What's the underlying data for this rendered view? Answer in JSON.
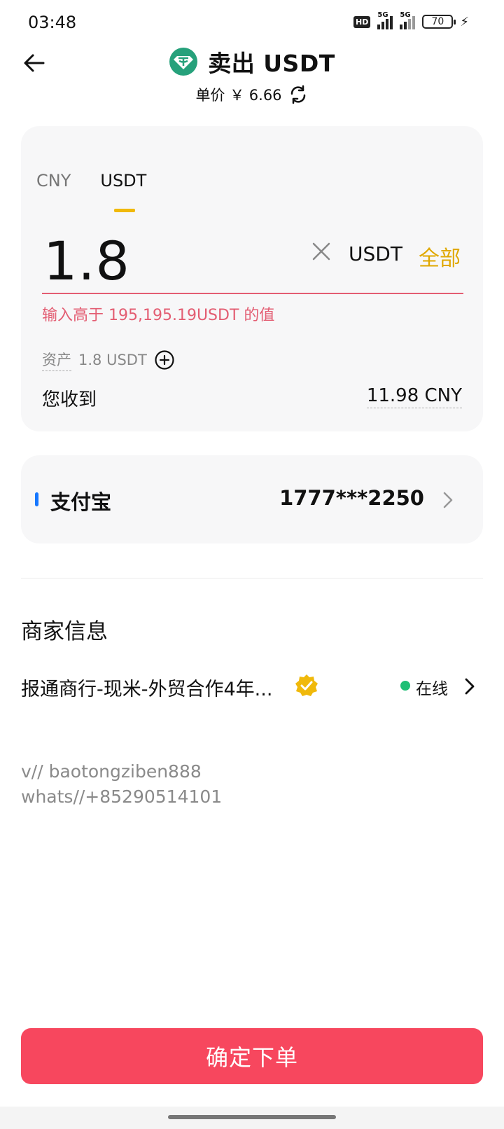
{
  "status_bar": {
    "time": "03:48",
    "hd_badge": "HD",
    "signal1_tag": "5G",
    "signal2_tag": "5G",
    "battery": "70"
  },
  "header": {
    "back_icon": "arrow-left-icon",
    "coin_icon": "tether-coin-icon",
    "title": "卖出 USDT",
    "price_label": "单价 ￥ 6.66",
    "refresh_icon": "refresh-icon"
  },
  "amount_card": {
    "tabs": [
      {
        "label": "CNY",
        "active": false
      },
      {
        "label": "USDT",
        "active": true
      }
    ],
    "amount_value": "1.8",
    "unit": "USDT",
    "max_label": "全部",
    "error_text": "输入高于 195,195.19USDT 的值",
    "asset_label": "资产",
    "asset_value": "1.8 USDT",
    "receive_label": "您收到",
    "receive_value": "11.98 CNY"
  },
  "payment": {
    "method": "支付宝",
    "account": "1777***2250",
    "accent_color": "#1677ff"
  },
  "merchant": {
    "section_title": "商家信息",
    "name": "报通商行-现米-外贸合作4年...",
    "status": "在线",
    "status_color": "#1fbf75"
  },
  "contact": {
    "line1": "v//  baotongziben888",
    "line2": "whats//+85290514101"
  },
  "confirm_button": {
    "label": "确定下单",
    "color": "#f7475e"
  },
  "colors": {
    "accent_yellow": "#f0b90b",
    "error_red": "#e35d72"
  }
}
